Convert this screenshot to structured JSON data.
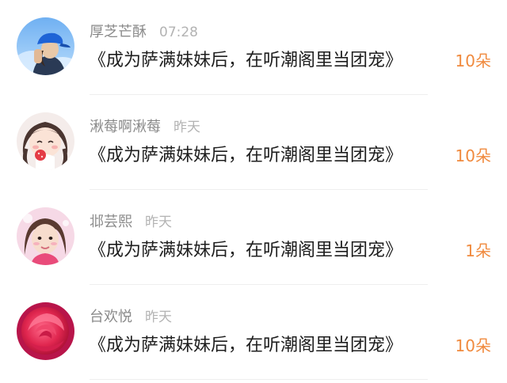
{
  "gifts": [
    {
      "name": "厚芝芒酥",
      "time": "07:28",
      "message": "《成为萨满妹妹后，在听潮阁里当团宠》",
      "count": "10朵",
      "avatar_icon": "person-blue-cap-avatar"
    },
    {
      "name": "湫莓啊湫莓",
      "time": "昨天",
      "message": "《成为萨满妹妹后，在听潮阁里当团宠》",
      "count": "10朵",
      "avatar_icon": "cartoon-girl-avatar"
    },
    {
      "name": "邶芸熙",
      "time": "昨天",
      "message": "《成为萨满妹妹后，在听潮阁里当团宠》",
      "count": "1朵",
      "avatar_icon": "girl-photo-avatar"
    },
    {
      "name": "台欢悦",
      "time": "昨天",
      "message": "《成为萨满妹妹后，在听潮阁里当团宠》",
      "count": "10朵",
      "avatar_icon": "red-rose-avatar"
    }
  ],
  "colors": {
    "count": "#f08a3e",
    "name": "#8a8a8a",
    "time": "#b3b3b3",
    "message": "#1e1e1e"
  }
}
